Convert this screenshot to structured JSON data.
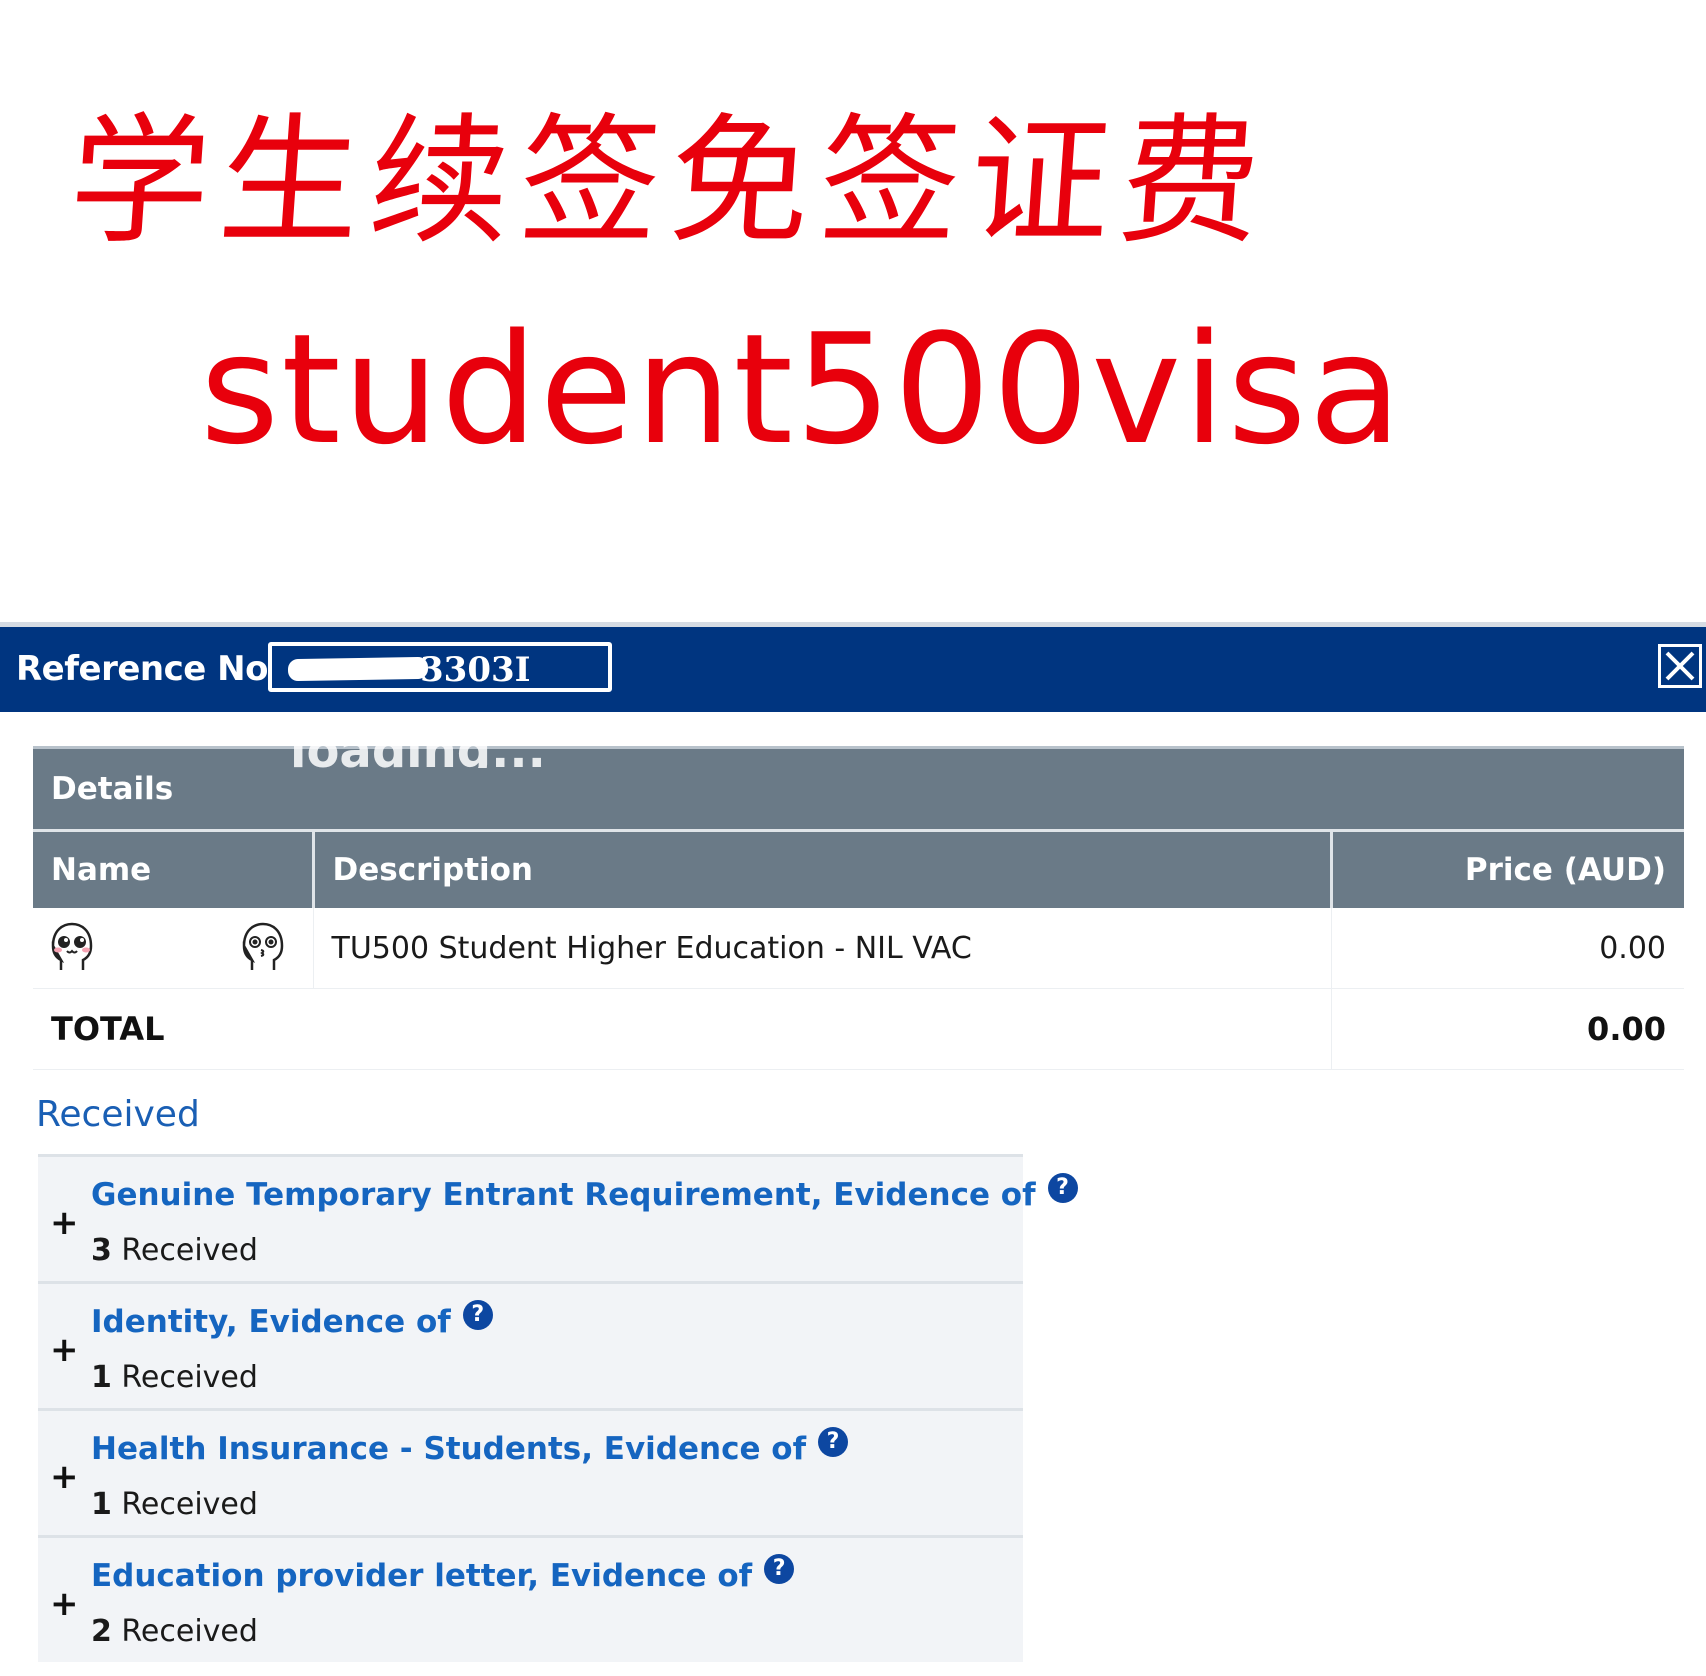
{
  "overlay": {
    "title_cn": "学生续签免签证费",
    "subtitle": "student500visa"
  },
  "header": {
    "reference_label": "Reference No",
    "reference_value": "3303I",
    "loading_text": "loading..."
  },
  "details": {
    "section_title": "Details",
    "columns": {
      "name": "Name",
      "description": "Description",
      "price": "Price (AUD)"
    },
    "items": [
      {
        "description": "TU500 Student Higher Education - NIL VAC",
        "price": "0.00"
      }
    ],
    "total_label": "TOTAL",
    "total_value": "0.00"
  },
  "received": {
    "heading": "Received",
    "items": [
      {
        "title": "Genuine Temporary Entrant Requirement, Evidence of",
        "count": "3",
        "count_label": "Received"
      },
      {
        "title": "Identity, Evidence of",
        "count": "1",
        "count_label": "Received"
      },
      {
        "title": "Health Insurance - Students, Evidence of",
        "count": "1",
        "count_label": "Received"
      },
      {
        "title": "Education provider letter, Evidence of",
        "count": "2",
        "count_label": "Received"
      }
    ]
  },
  "icons": {
    "close": "close-icon",
    "help": "help-icon",
    "expand": "plus-icon"
  },
  "colors": {
    "header_bg": "#003580",
    "table_header_bg": "#6a7a87",
    "link_blue": "#1565c0",
    "overlay_red": "#e8000c"
  }
}
